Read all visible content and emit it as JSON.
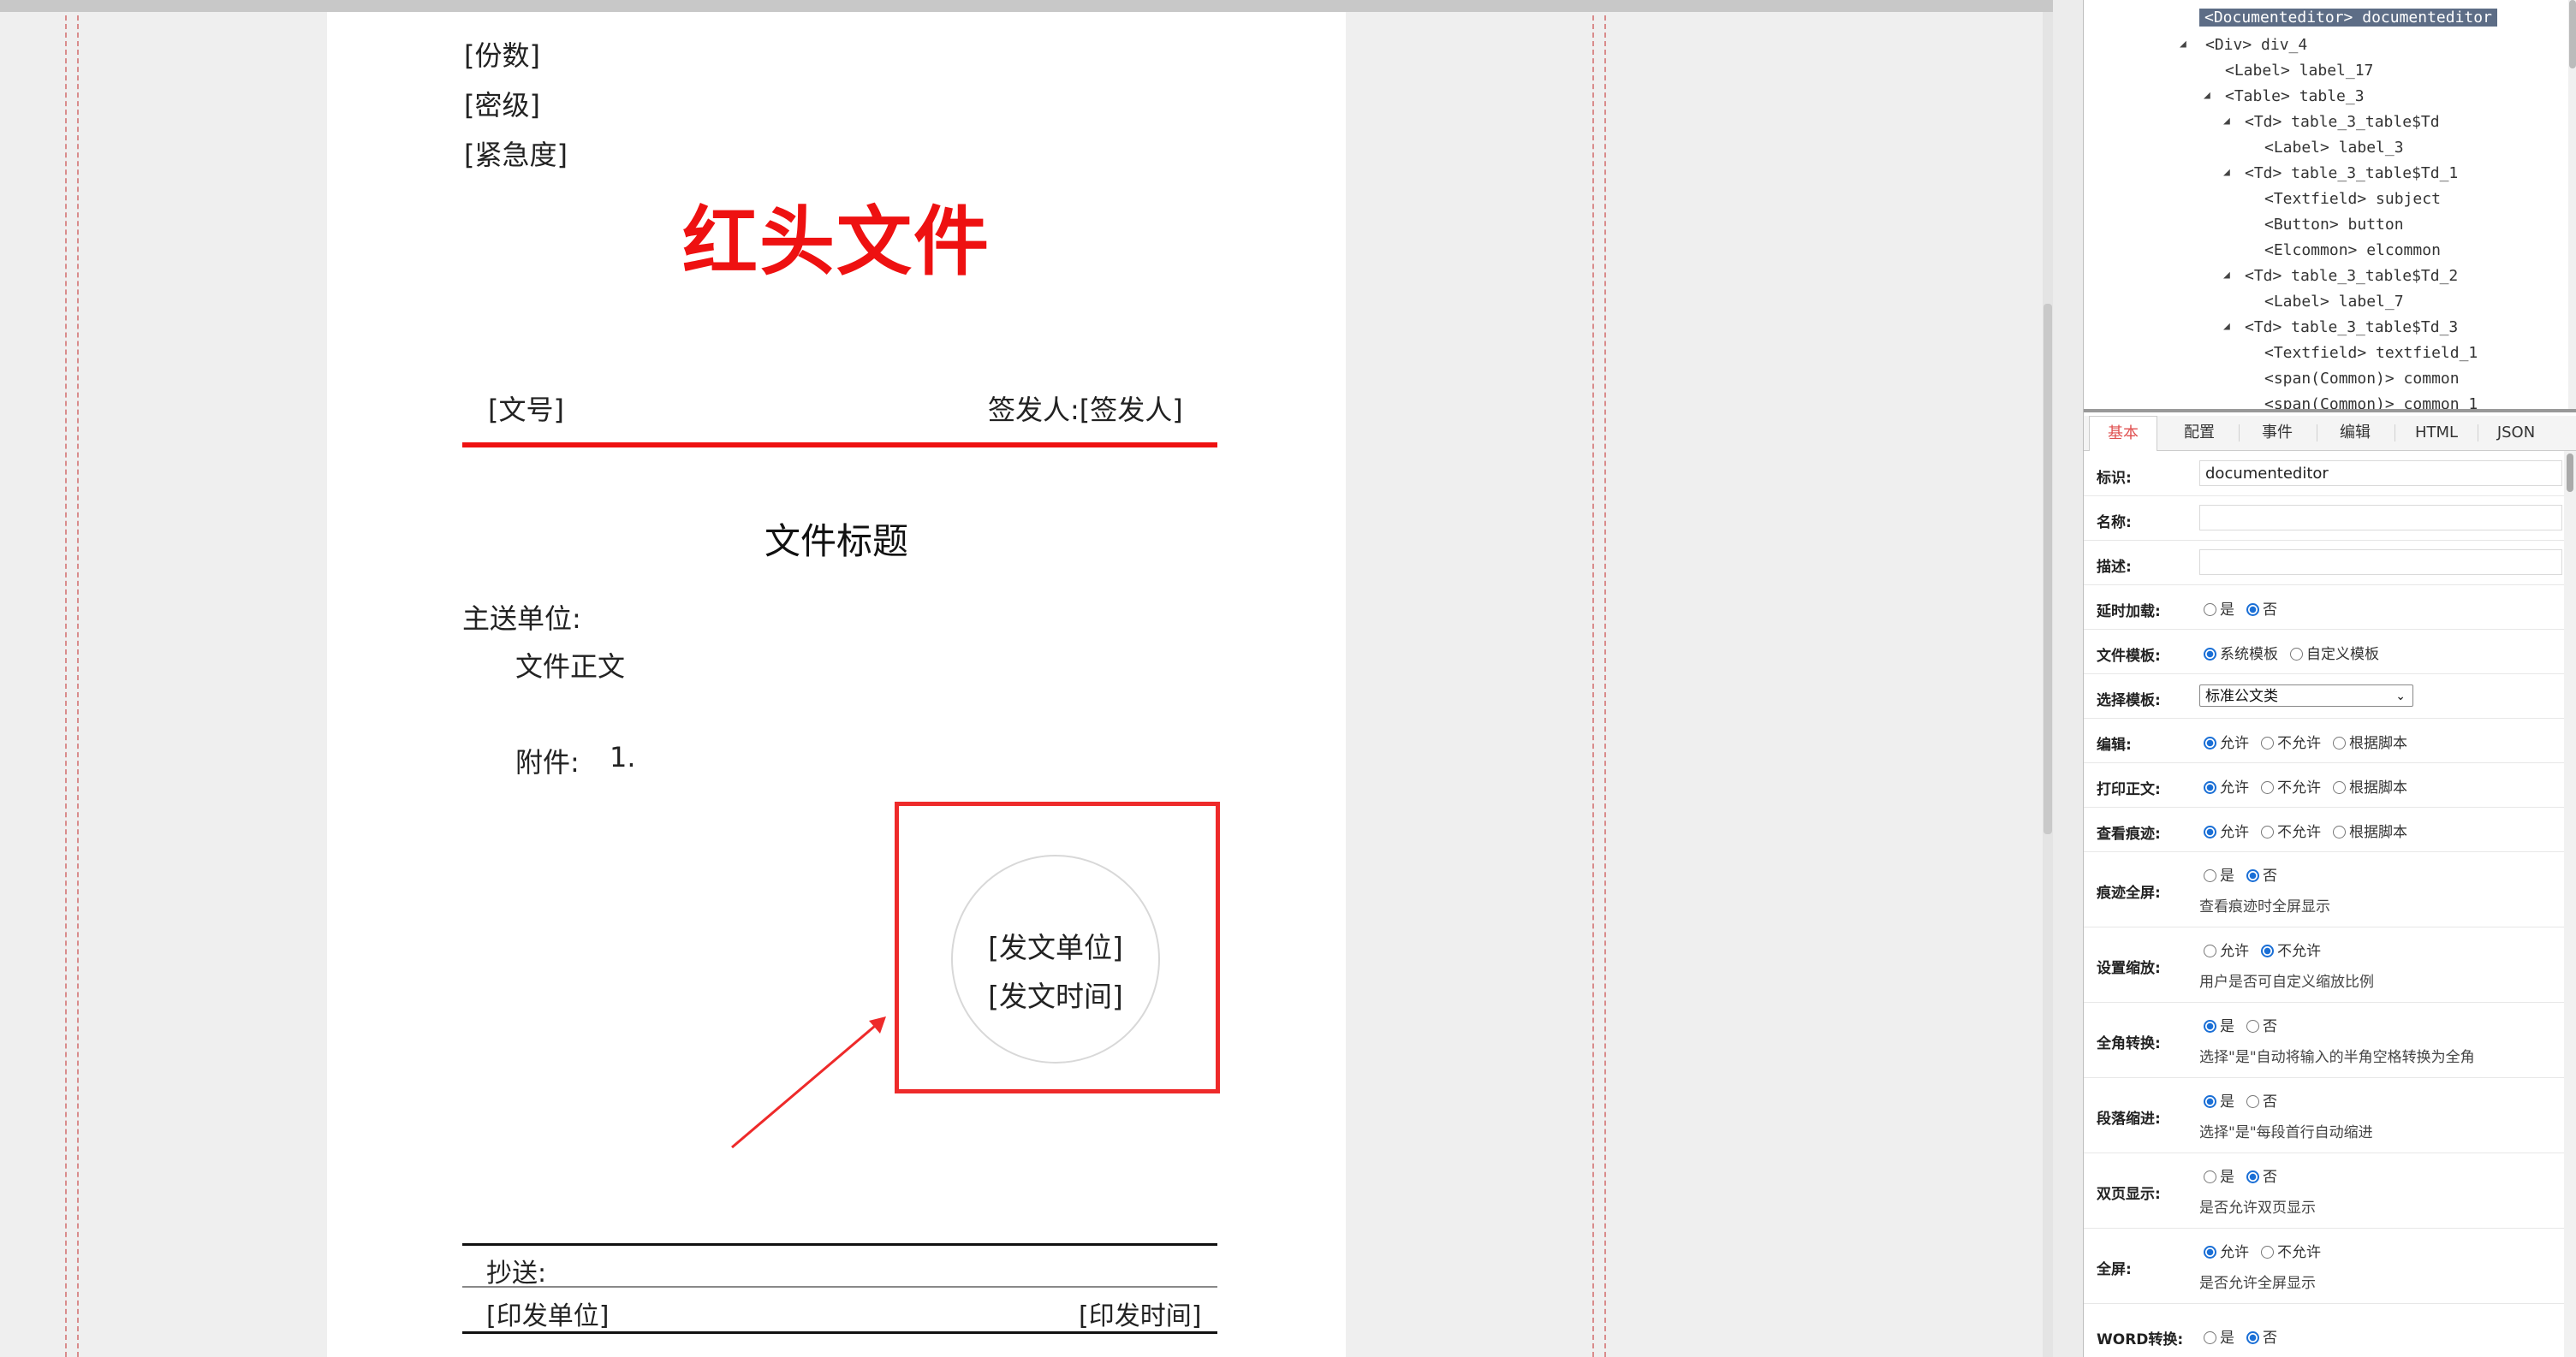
{
  "document": {
    "copies_label": "[份数]",
    "secret_label": "[密级]",
    "urgency_label": "[紧急度]",
    "header_title": "红头文件",
    "doc_number": "[文号]",
    "signer": "签发人:[签发人]",
    "file_title": "文件标题",
    "main_recipient": "主送单位:",
    "body_text": "文件正文",
    "attachment": "附件:",
    "attachment_item": "1.",
    "issuing_unit": "[发文单位]",
    "issue_time": "[发文时间]",
    "cc_label": "抄送:",
    "print_unit": "[印发单位]",
    "print_time": "[印发时间]"
  },
  "tree": {
    "nodes": [
      {
        "text": "<Documenteditor> documenteditor",
        "selected": true,
        "toggle": ""
      },
      {
        "text": "<Div> div_4",
        "toggle": "◢"
      },
      {
        "text": "<Label> label_17",
        "toggle": ""
      },
      {
        "text": "<Table> table_3",
        "toggle": "◢"
      },
      {
        "text": "<Td> table_3_table$Td",
        "toggle": "◢"
      },
      {
        "text": "<Label> label_3",
        "toggle": ""
      },
      {
        "text": "<Td> table_3_table$Td_1",
        "toggle": "◢"
      },
      {
        "text": "<Textfield> subject",
        "toggle": ""
      },
      {
        "text": "<Button> button",
        "toggle": ""
      },
      {
        "text": "<Elcommon> elcommon",
        "toggle": ""
      },
      {
        "text": "<Td> table_3_table$Td_2",
        "toggle": "◢"
      },
      {
        "text": "<Label> label_7",
        "toggle": ""
      },
      {
        "text": "<Td> table_3_table$Td_3",
        "toggle": "◢"
      },
      {
        "text": "<Textfield> textfield_1",
        "toggle": ""
      },
      {
        "text": "<span(Common)> common",
        "toggle": ""
      },
      {
        "text": "<span(Common)> common_1",
        "toggle": ""
      }
    ]
  },
  "tabs": [
    "基本",
    "配置",
    "事件",
    "编辑",
    "HTML",
    "JSON"
  ],
  "props": {
    "id_label": "标识:",
    "id_value": "documenteditor",
    "name_label": "名称:",
    "desc_label": "描述:",
    "lazy_label": "延时加载:",
    "template_label": "文件模板:",
    "template_opt1": "系统模板",
    "template_opt2": "自定义模板",
    "choose_label": "选择模板:",
    "choose_value": "标准公文类",
    "edit_label": "编辑:",
    "print_label": "打印正文:",
    "trace_label": "查看痕迹:",
    "trace_full_label": "痕迹全屏:",
    "trace_full_hint": "查看痕迹时全屏显示",
    "zoom_label": "设置缩放:",
    "zoom_hint": "用户是否可自定义缩放比例",
    "fullwidth_label": "全角转换:",
    "fullwidth_hint": "选择\"是\"自动将输入的半角空格转换为全角",
    "indent_label": "段落缩进:",
    "indent_hint": "选择\"是\"每段首行自动缩进",
    "double_label": "双页显示:",
    "double_hint": "是否允许双页显示",
    "fullscreen_label": "全屏:",
    "fullscreen_hint": "是否允许全屏显示",
    "word_label": "WORD转换:",
    "yes": "是",
    "no": "否",
    "allow": "允许",
    "disallow": "不允许",
    "by_script": "根据脚本"
  },
  "colors": {
    "red_header": "#ee1111",
    "tab_active": "#e05050",
    "radio_on": "#1a6fd6",
    "tree_selected": "#5d6d86"
  }
}
